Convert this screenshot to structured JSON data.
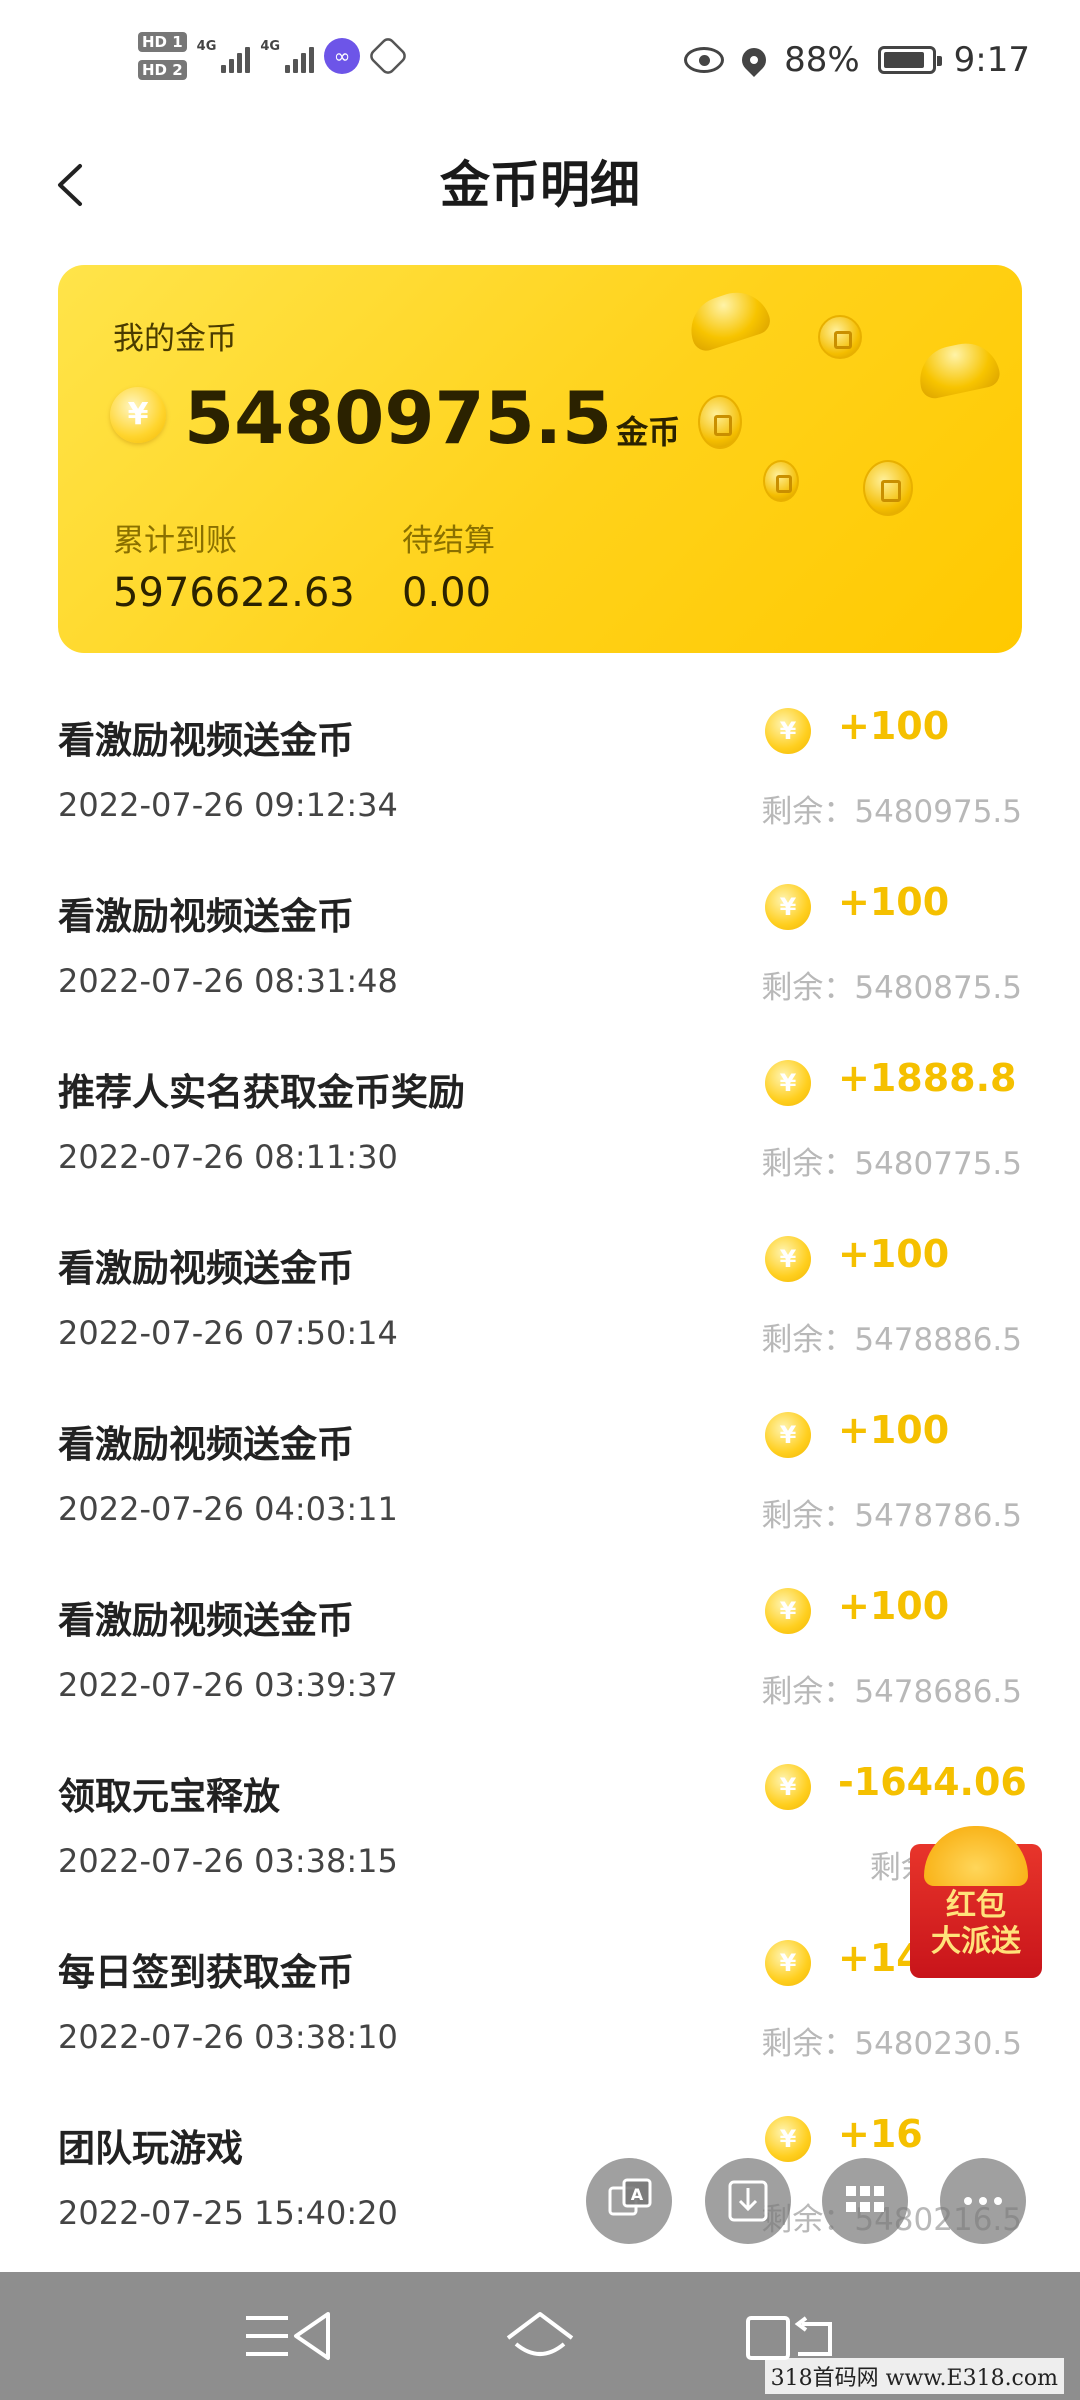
{
  "status_bar": {
    "hd1": "HD 1",
    "hd2": "HD 2",
    "net1": "4G",
    "net2": "4G",
    "battery_percent": "88%",
    "time": "9:17",
    "battery_level": 0.88
  },
  "header": {
    "title": "金币明细"
  },
  "card": {
    "label": "我的金币",
    "yen_symbol": "¥",
    "balance": "5480975.5",
    "unit": "金币",
    "stats": [
      {
        "label": "累计到账",
        "value": "5976622.63"
      },
      {
        "label": "待结算",
        "value": "0.00"
      }
    ]
  },
  "transactions": [
    {
      "title": "看激励视频送金币",
      "time": "2022-07-26 09:12:34",
      "amount": "+100",
      "remaining": "剩余：5480975.5"
    },
    {
      "title": "看激励视频送金币",
      "time": "2022-07-26 08:31:48",
      "amount": "+100",
      "remaining": "剩余：5480875.5"
    },
    {
      "title": "推荐人实名获取金币奖励",
      "time": "2022-07-26 08:11:30",
      "amount": "+1888.8",
      "remaining": "剩余：5480775.5"
    },
    {
      "title": "看激励视频送金币",
      "time": "2022-07-26 07:50:14",
      "amount": "+100",
      "remaining": "剩余：5478886.5"
    },
    {
      "title": "看激励视频送金币",
      "time": "2022-07-26 04:03:11",
      "amount": "+100",
      "remaining": "剩余：5478786.5"
    },
    {
      "title": "看激励视频送金币",
      "time": "2022-07-26 03:39:37",
      "amount": "+100",
      "remaining": "剩余：5478686.5"
    },
    {
      "title": "领取元宝释放",
      "time": "2022-07-26 03:38:15",
      "amount": "-1644.06",
      "remaining": "剩余：547"
    },
    {
      "title": "每日签到获取金币",
      "time": "2022-07-26 03:38:10",
      "amount": "+14",
      "remaining": "剩余：5480230.5"
    },
    {
      "title": "团队玩游戏",
      "time": "2022-07-25 15:40:20",
      "amount": "+16",
      "remaining": "剩余：5480216.5"
    }
  ],
  "red_envelope": {
    "line1": "红包",
    "line2": "大派送"
  },
  "watermark": "318首码网 www.E318.com",
  "colors": {
    "accent": "#ffd21a",
    "amount": "#f5c000",
    "remain": "#b8b8b8"
  }
}
